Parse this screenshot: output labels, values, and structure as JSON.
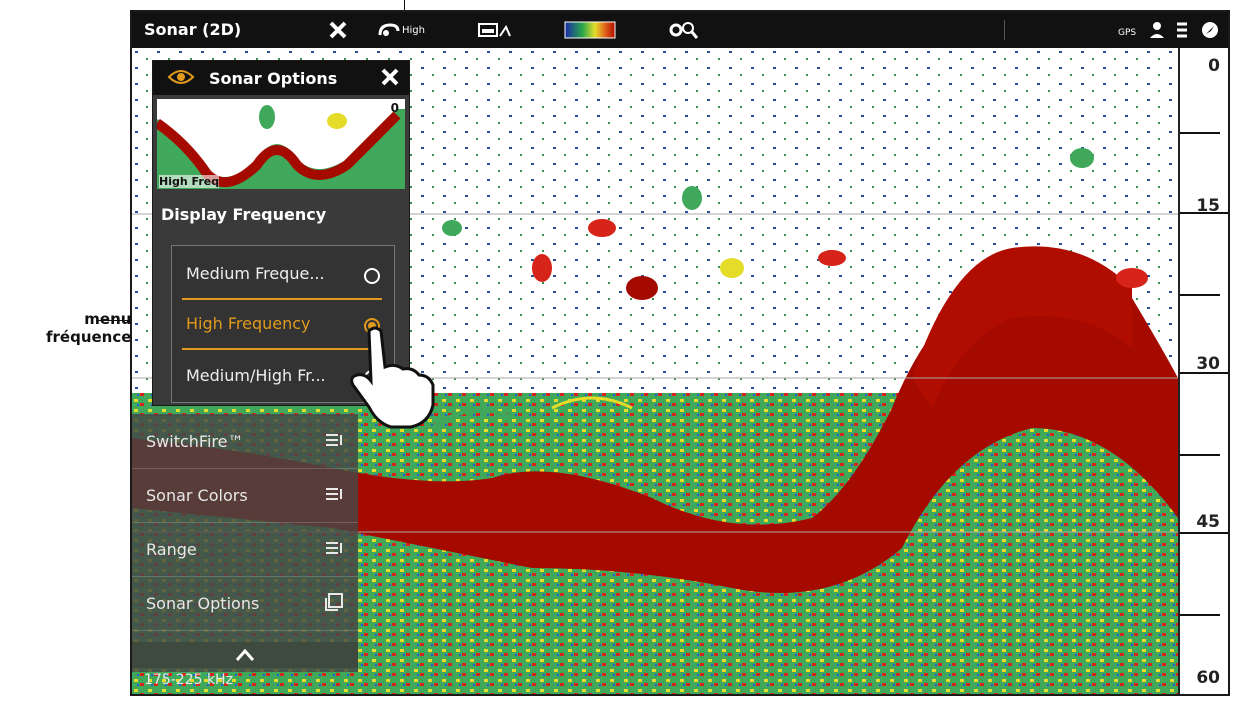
{
  "topbar": {
    "title": "Sonar (2D)",
    "frequency_badge": "High",
    "icons": [
      "close-icon",
      "frequency-icon",
      "chart-sonar-icon",
      "color-palette-icon",
      "settings-zoom-icon",
      "gps-icon",
      "user-icon",
      "depth-icon",
      "compass-icon"
    ]
  },
  "depth_scale": {
    "labels": [
      "0",
      "15",
      "30",
      "45",
      "60"
    ]
  },
  "options_panel": {
    "title": "Sonar Options",
    "preview_label": "High Freq",
    "preview_depth": "0",
    "section_title": "Display Frequency",
    "options": [
      {
        "label": "Medium Freque...",
        "selected": false
      },
      {
        "label": "High Frequency",
        "selected": true
      },
      {
        "label": "Medium/High Fr...",
        "selected": false
      }
    ]
  },
  "side_menu": {
    "items": [
      {
        "label": "SwitchFire™"
      },
      {
        "label": "Sonar Colors"
      },
      {
        "label": "Range"
      },
      {
        "label": "Sonar Options"
      }
    ],
    "freq_readout": "175-225 kHz"
  },
  "callout": {
    "text_line1": "menu",
    "text_line2": "fréquence"
  },
  "colors": {
    "accent": "#e29a1c",
    "bar": "#111111",
    "deep": "#a50a00"
  }
}
